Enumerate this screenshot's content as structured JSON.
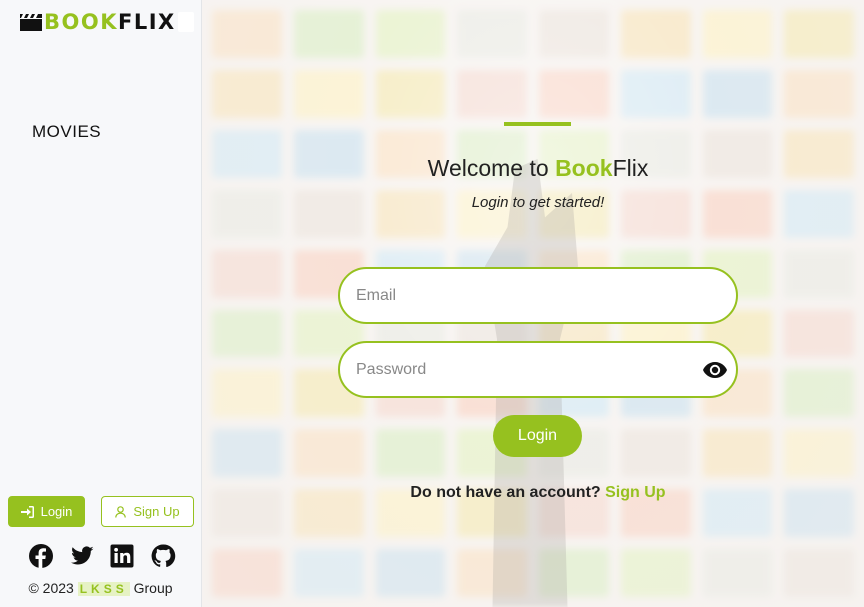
{
  "brand": {
    "part1": "BOOK",
    "part2": "FLIX"
  },
  "nav": {
    "movies": "MOVIES"
  },
  "sidebar": {
    "login_label": "Login",
    "signup_label": "Sign Up",
    "socials": [
      "facebook-icon",
      "twitter-icon",
      "linkedin-icon",
      "github-icon"
    ],
    "copyright_prefix": "© 2023",
    "copyright_org": "LKSS",
    "copyright_suffix": "Group"
  },
  "main": {
    "welcome_prefix": "Welcome to ",
    "welcome_book": "Book",
    "welcome_flix": "Flix",
    "subtitle": "Login to get started!",
    "email_placeholder": "Email",
    "password_placeholder": "Password",
    "login_button": "Login",
    "no_account_text": "Do not have an account?",
    "signup_link": "Sign Up"
  },
  "colors": {
    "accent": "#96c11f",
    "text": "#222222",
    "sidebar_bg": "#f7f8fa"
  }
}
